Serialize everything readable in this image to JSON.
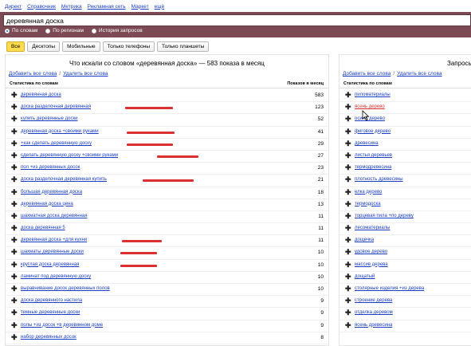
{
  "topnav": [
    "Директ",
    "Справочник",
    "Метрика",
    "Рекламная сеть",
    "Маркет",
    "ещё"
  ],
  "search": {
    "value": "деревянная доска",
    "radios": [
      {
        "label": "По словам",
        "selected": true
      },
      {
        "label": "По регионам",
        "selected": false
      },
      {
        "label": "История запросов",
        "selected": false
      }
    ]
  },
  "tabs": [
    {
      "label": "Все",
      "active": true
    },
    {
      "label": "Десктопы",
      "active": false
    },
    {
      "label": "Мобильные",
      "active": false
    },
    {
      "label": "Только телефоны",
      "active": false
    },
    {
      "label": "Только планшеты",
      "active": false
    }
  ],
  "left": {
    "title": "Что искали со словом «деревянная доска» — 583 показа в месяц",
    "add_all": "Добавить все слова",
    "sep": "/",
    "remove_all": "Удалить все слова",
    "col_word": "Статистика по словам",
    "col_count": "Показов в месяц",
    "rows": [
      {
        "word": "деревянная доска",
        "count": "583",
        "strike": false
      },
      {
        "word": "доска разделочная деревянная",
        "count": "123",
        "strike": true
      },
      {
        "word": "купить деревянные доски",
        "count": "52",
        "strike": false
      },
      {
        "word": "деревянная доска +своими руками",
        "count": "41",
        "strike": true
      },
      {
        "word": "+как сделать деревянную доску",
        "count": "29",
        "strike": true
      },
      {
        "word": "сделать деревянную доску +своими руками",
        "count": "27",
        "strike": true
      },
      {
        "word": "пол +из деревянных досок",
        "count": "23",
        "strike": false
      },
      {
        "word": "доска разделочная деревянная купить",
        "count": "21",
        "strike": true
      },
      {
        "word": "большая деревянная доска",
        "count": "18",
        "strike": false
      },
      {
        "word": "деревянная доска цена",
        "count": "13",
        "strike": false
      },
      {
        "word": "шахматная доска деревянная",
        "count": "11",
        "strike": false
      },
      {
        "word": "доска деревянная 5",
        "count": "11",
        "strike": false
      },
      {
        "word": "деревянная доска +для кухни",
        "count": "11",
        "strike": true
      },
      {
        "word": "шахматы деревянные доски",
        "count": "10",
        "strike": true
      },
      {
        "word": "круглая доска деревянная",
        "count": "10",
        "strike": true
      },
      {
        "word": "ламинат под деревянную доску",
        "count": "10",
        "strike": false
      },
      {
        "word": "выравнивание досок деревянных полов",
        "count": "10",
        "strike": false
      },
      {
        "word": "доска деревянного настила",
        "count": "9",
        "strike": false
      },
      {
        "word": "темные деревянные доски",
        "count": "9",
        "strike": false
      },
      {
        "word": "полы +из досок +в деревянном доме",
        "count": "9",
        "strike": false
      },
      {
        "word": "набор деревянных досок",
        "count": "8",
        "strike": false
      }
    ]
  },
  "right": {
    "title": "Запросы, п",
    "add_all": "Добавить все слова",
    "sep": "/",
    "remove_all": "Удалить все слова",
    "col_word": "Статистика по словам",
    "rows": [
      {
        "word": "пиломатериалы"
      },
      {
        "word": "ясень дерево"
      },
      {
        "word": "осина дерево"
      },
      {
        "word": "фиговое дерево"
      },
      {
        "word": "древесина"
      },
      {
        "word": "листья деревьев"
      },
      {
        "word": "термодревесина"
      },
      {
        "word": "плотность древесины"
      },
      {
        "word": "елка дерево"
      },
      {
        "word": "термодоска"
      },
      {
        "word": "торцевая пила +по дереву"
      },
      {
        "word": "лесоматериалы"
      },
      {
        "word": "дощечка"
      },
      {
        "word": "удовое дерево"
      },
      {
        "word": "массив дерева"
      },
      {
        "word": "дощатый"
      },
      {
        "word": "столярные изделия +из дерева"
      },
      {
        "word": "строение дерева"
      },
      {
        "word": "отделка деревом"
      },
      {
        "word": "ясень древесина"
      }
    ]
  },
  "colors": {
    "accent_bar": "#7b4a55",
    "active_tab": "#ffdb4d",
    "link": "#1a3dc1",
    "strike": "#d93131"
  }
}
